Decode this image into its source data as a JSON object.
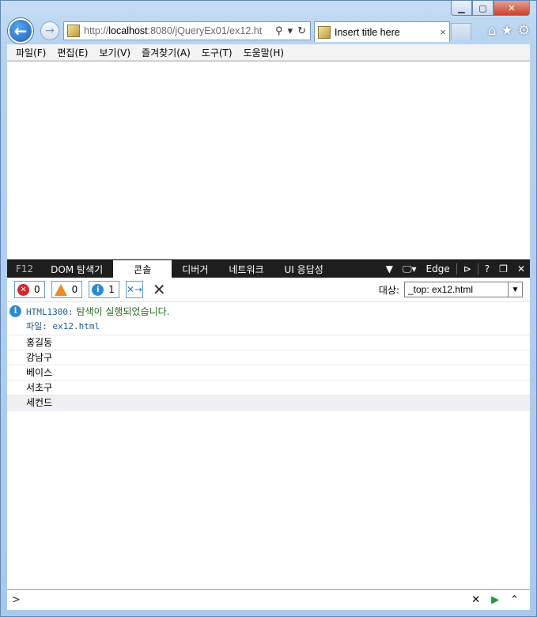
{
  "browser": {
    "address": {
      "protocol": "http://",
      "host": "localhost",
      "path": ":8080/jQueryEx01/ex12.ht"
    },
    "tab_title": "Insert title here",
    "tab_close": "×"
  },
  "menu": [
    "파일(F)",
    "편집(E)",
    "보기(V)",
    "즐겨찾기(A)",
    "도구(T)",
    "도움말(H)"
  ],
  "devtools": {
    "tabs": {
      "f12": "F12",
      "dom": "DOM 탐색기",
      "console": "콘솔",
      "debugger": "디버거",
      "network": "네트워크",
      "ui": "UI 응답성"
    },
    "emulation_mode": "Edge",
    "help": "?",
    "filters": {
      "errors": "0",
      "warnings": "0",
      "info": "1"
    },
    "target_label": "대상:",
    "target_value": "_top: ex12.html",
    "messages": {
      "code": "HTML1300:",
      "text": "탐색이 실행되었습니다.",
      "file": "파일: ex12.html"
    },
    "logs": [
      "홍길동",
      "강남구",
      "베이스",
      "서초구",
      "세컨드"
    ],
    "prompt": ">"
  }
}
